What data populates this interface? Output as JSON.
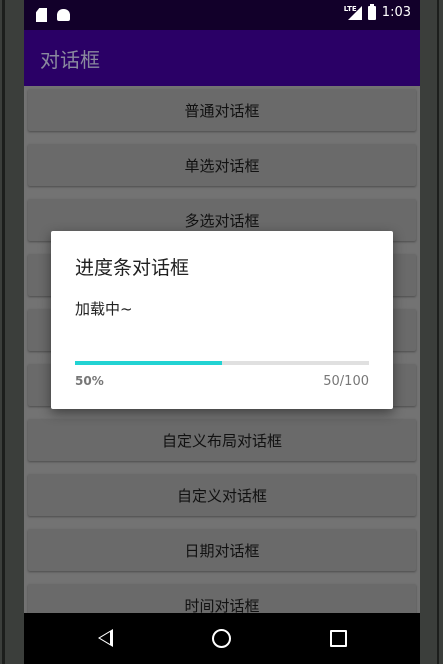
{
  "statusbar": {
    "time": "1:03",
    "network": "LTE"
  },
  "appbar": {
    "title": "对话框"
  },
  "buttons": [
    "普通对话框",
    "单选对话框",
    "多选对话框",
    "",
    "",
    "",
    "自定义布局对话框",
    "自定义对话框",
    "日期对话框",
    "时间对话框"
  ],
  "dialog": {
    "title": "进度条对话框",
    "message": "加载中~",
    "progress": 50,
    "max": 100,
    "percent_label": "50%",
    "number_label": "50/100",
    "accent_color": "#22d3d3"
  },
  "icons": [
    "sd-card-icon",
    "android-icon",
    "lte-signal-icon",
    "battery-icon",
    "back-icon",
    "home-icon",
    "recents-icon"
  ]
}
